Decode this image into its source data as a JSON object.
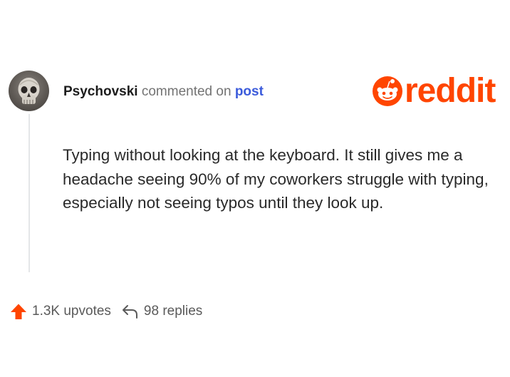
{
  "comment": {
    "username": "Psychovski",
    "action_text": "commented on",
    "target_link": "post",
    "body": "Typing without looking at the keyboard. It still gives me a headache seeing 90% of my coworkers struggle with typing, especially not seeing typos until they look up."
  },
  "brand": {
    "wordmark": "reddit",
    "icon": "reddit-snoo-icon",
    "color": "#ff4500"
  },
  "stats": {
    "upvotes_label": "1.3K upvotes",
    "upvote_icon": "upvote-arrow-icon",
    "replies_label": "98 replies",
    "reply_icon": "reply-arrow-icon"
  },
  "colors": {
    "link": "#3b5bdb",
    "upvote": "#ff4500",
    "meta_text": "#737373"
  }
}
